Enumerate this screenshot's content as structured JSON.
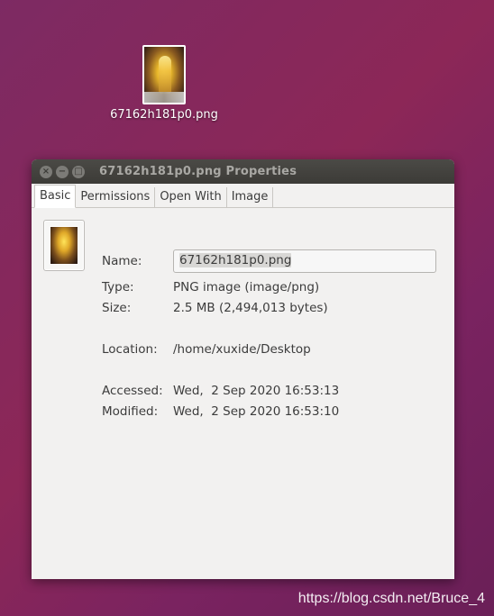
{
  "desktop": {
    "icon_label": "67162h181p0.png"
  },
  "window": {
    "title": "67162h181p0.png Properties",
    "buttons": {
      "close": "×",
      "minimize": "−",
      "maximize": "□"
    },
    "tabs": [
      {
        "label": "Basic",
        "active": true
      },
      {
        "label": "Permissions",
        "active": false
      },
      {
        "label": "Open With",
        "active": false
      },
      {
        "label": "Image",
        "active": false
      }
    ],
    "basic": {
      "name_label": "Name:",
      "name_value": "67162h181p0.png",
      "type_label": "Type:",
      "type_value": "PNG image (image/png)",
      "size_label": "Size:",
      "size_value": "2.5 MB (2,494,013 bytes)",
      "location_label": "Location:",
      "location_value": "/home/xuxide/Desktop",
      "accessed_label": "Accessed:",
      "accessed_value": "Wed,  2 Sep 2020 16:53:13",
      "modified_label": "Modified:",
      "modified_value": "Wed,  2 Sep 2020 16:53:10"
    }
  },
  "watermark": "https://blog.csdn.net/Bruce_4",
  "colors": {
    "desktop_bg": "#7d2a63",
    "titlebar": "#3c3b37",
    "window_bg": "#f2f1f0"
  }
}
